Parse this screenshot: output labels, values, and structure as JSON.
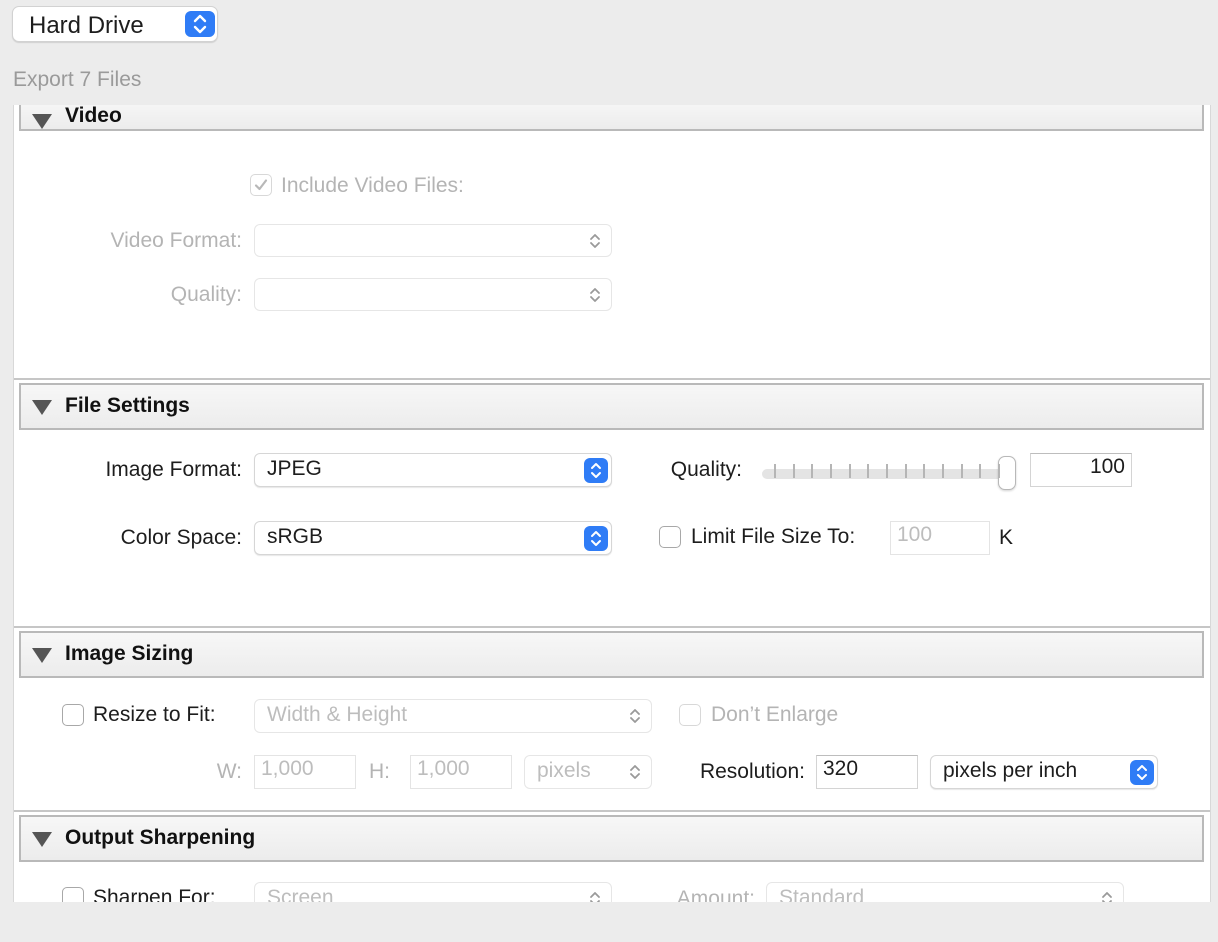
{
  "destination": {
    "value": "Hard Drive",
    "icon": "updown-chevron-icon"
  },
  "export_count": "Export 7 Files",
  "video": {
    "title": "Video",
    "include_label": "Include Video Files:",
    "include_checked": true,
    "format_label": "Video Format:",
    "format_value": "",
    "quality_label": "Quality:",
    "quality_value": ""
  },
  "file_settings": {
    "title": "File Settings",
    "image_format_label": "Image Format:",
    "image_format_value": "JPEG",
    "color_space_label": "Color Space:",
    "color_space_value": "sRGB",
    "quality_label": "Quality:",
    "quality_value": "100",
    "quality_slider_fraction": 1.0,
    "limit_label": "Limit File Size To:",
    "limit_value": "100",
    "limit_unit": "K",
    "limit_checked": false
  },
  "image_sizing": {
    "title": "Image Sizing",
    "resize_label": "Resize to Fit:",
    "resize_checked": false,
    "resize_mode": "Width & Height",
    "dont_enlarge_label": "Don’t Enlarge",
    "w_label": "W:",
    "w_value": "1,000",
    "h_label": "H:",
    "h_value": "1,000",
    "units": "pixels",
    "resolution_label": "Resolution:",
    "resolution_value": "320",
    "resolution_units": "pixels per inch"
  },
  "output_sharpening": {
    "title": "Output Sharpening",
    "sharpen_label": "Sharpen For:",
    "sharpen_for": "Screen",
    "amount_label": "Amount:",
    "amount_value": "Standard"
  },
  "colors": {
    "accent": "#2f7cf6",
    "disabled_text": "#b4b4b4"
  }
}
